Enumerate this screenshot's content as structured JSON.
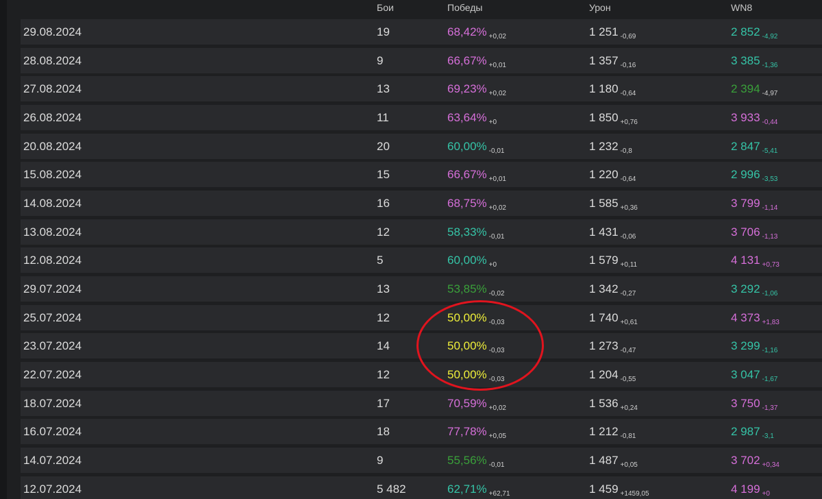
{
  "header": {
    "battles": "Бои",
    "wins": "Победы",
    "damage": "Урон",
    "wn8": "WN8"
  },
  "colors": {
    "violet": "#d66fd9",
    "teal": "#35c4a7",
    "green": "#3aa03a",
    "yellow": "#eeee3a",
    "white": "#dcdcdc"
  },
  "rows": [
    {
      "date": "29.08.2024",
      "battles": "19",
      "wins": "68,42%",
      "wins_delta": "+0,02",
      "wins_color": "violet",
      "damage": "1 251",
      "damage_delta": "-0,69",
      "wn8": "2 852",
      "wn8_delta": "-4,92",
      "wn8_color": "teal"
    },
    {
      "date": "28.08.2024",
      "battles": "9",
      "wins": "66,67%",
      "wins_delta": "+0,01",
      "wins_color": "violet",
      "damage": "1 357",
      "damage_delta": "-0,16",
      "wn8": "3 385",
      "wn8_delta": "-1,36",
      "wn8_color": "teal"
    },
    {
      "date": "27.08.2024",
      "battles": "13",
      "wins": "69,23%",
      "wins_delta": "+0,02",
      "wins_color": "violet",
      "damage": "1 180",
      "damage_delta": "-0,64",
      "wn8": "2 394",
      "wn8_delta": "-4,97",
      "wn8_color": "green"
    },
    {
      "date": "26.08.2024",
      "battles": "11",
      "wins": "63,64%",
      "wins_delta": "+0",
      "wins_color": "violet",
      "damage": "1 850",
      "damage_delta": "+0,76",
      "wn8": "3 933",
      "wn8_delta": "-0,44",
      "wn8_color": "violet"
    },
    {
      "date": "20.08.2024",
      "battles": "20",
      "wins": "60,00%",
      "wins_delta": "-0,01",
      "wins_color": "teal",
      "damage": "1 232",
      "damage_delta": "-0,8",
      "wn8": "2 847",
      "wn8_delta": "-5,41",
      "wn8_color": "teal"
    },
    {
      "date": "15.08.2024",
      "battles": "15",
      "wins": "66,67%",
      "wins_delta": "+0,01",
      "wins_color": "violet",
      "damage": "1 220",
      "damage_delta": "-0,64",
      "wn8": "2 996",
      "wn8_delta": "-3,53",
      "wn8_color": "teal"
    },
    {
      "date": "14.08.2024",
      "battles": "16",
      "wins": "68,75%",
      "wins_delta": "+0,02",
      "wins_color": "violet",
      "damage": "1 585",
      "damage_delta": "+0,36",
      "wn8": "3 799",
      "wn8_delta": "-1,14",
      "wn8_color": "violet"
    },
    {
      "date": "13.08.2024",
      "battles": "12",
      "wins": "58,33%",
      "wins_delta": "-0,01",
      "wins_color": "teal",
      "damage": "1 431",
      "damage_delta": "-0,06",
      "wn8": "3 706",
      "wn8_delta": "-1,13",
      "wn8_color": "violet"
    },
    {
      "date": "12.08.2024",
      "battles": "5",
      "wins": "60,00%",
      "wins_delta": "+0",
      "wins_color": "teal",
      "damage": "1 579",
      "damage_delta": "+0,11",
      "wn8": "4 131",
      "wn8_delta": "+0,73",
      "wn8_color": "violet"
    },
    {
      "date": "29.07.2024",
      "battles": "13",
      "wins": "53,85%",
      "wins_delta": "-0,02",
      "wins_color": "green",
      "damage": "1 342",
      "damage_delta": "-0,27",
      "wn8": "3 292",
      "wn8_delta": "-1,06",
      "wn8_color": "teal"
    },
    {
      "date": "25.07.2024",
      "battles": "12",
      "wins": "50,00%",
      "wins_delta": "-0,03",
      "wins_color": "yellow",
      "damage": "1 740",
      "damage_delta": "+0,61",
      "wn8": "4 373",
      "wn8_delta": "+1,83",
      "wn8_color": "violet"
    },
    {
      "date": "23.07.2024",
      "battles": "14",
      "wins": "50,00%",
      "wins_delta": "-0,03",
      "wins_color": "yellow",
      "damage": "1 273",
      "damage_delta": "-0,47",
      "wn8": "3 299",
      "wn8_delta": "-1,16",
      "wn8_color": "teal"
    },
    {
      "date": "22.07.2024",
      "battles": "12",
      "wins": "50,00%",
      "wins_delta": "-0,03",
      "wins_color": "yellow",
      "damage": "1 204",
      "damage_delta": "-0,55",
      "wn8": "3 047",
      "wn8_delta": "-1,67",
      "wn8_color": "teal"
    },
    {
      "date": "18.07.2024",
      "battles": "17",
      "wins": "70,59%",
      "wins_delta": "+0,02",
      "wins_color": "violet",
      "damage": "1 536",
      "damage_delta": "+0,24",
      "wn8": "3 750",
      "wn8_delta": "-1,37",
      "wn8_color": "violet"
    },
    {
      "date": "16.07.2024",
      "battles": "18",
      "wins": "77,78%",
      "wins_delta": "+0,05",
      "wins_color": "violet",
      "damage": "1 212",
      "damage_delta": "-0,81",
      "wn8": "2 987",
      "wn8_delta": "-3,1",
      "wn8_color": "teal"
    },
    {
      "date": "14.07.2024",
      "battles": "9",
      "wins": "55,56%",
      "wins_delta": "-0,01",
      "wins_color": "green",
      "damage": "1 487",
      "damage_delta": "+0,05",
      "wn8": "3 702",
      "wn8_delta": "+0,34",
      "wn8_color": "violet"
    },
    {
      "date": "12.07.2024",
      "battles": "5 482",
      "wins": "62,71%",
      "wins_delta": "+62,71",
      "wins_color": "teal",
      "damage": "1 459",
      "damage_delta": "+1459,05",
      "wn8": "4 199",
      "wn8_delta": "+0",
      "wn8_color": "violet"
    }
  ]
}
